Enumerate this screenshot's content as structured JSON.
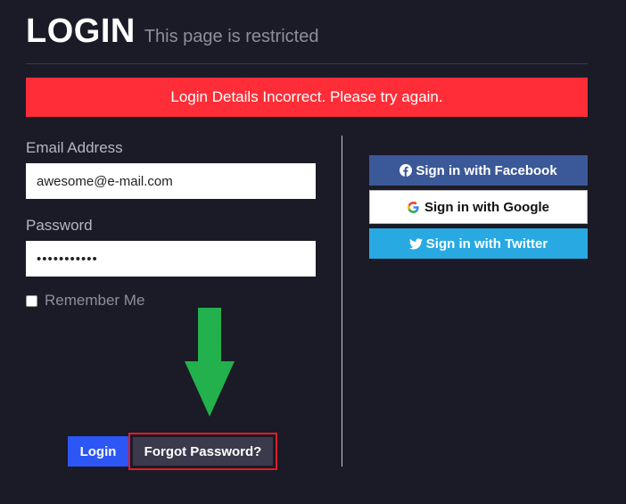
{
  "header": {
    "title": "LOGIN",
    "subtitle": "This page is restricted"
  },
  "alert": {
    "message": "Login Details Incorrect. Please try again.",
    "color": "#ff2d37"
  },
  "form": {
    "email_label": "Email Address",
    "email_value": "awesome@e-mail.com",
    "password_label": "Password",
    "password_value": "•••••••••••",
    "remember_label": "Remember Me",
    "remember_checked": false,
    "login_button": "Login",
    "forgot_button": "Forgot Password?"
  },
  "social": {
    "facebook_label": "Sign in with Facebook",
    "google_label": "Sign in with Google",
    "twitter_label": "Sign in with Twitter",
    "facebook_color": "#3b5998",
    "twitter_color": "#28a9e2"
  },
  "annotations": {
    "arrow_color": "#22b14c",
    "highlight_color": "#e01b24"
  }
}
